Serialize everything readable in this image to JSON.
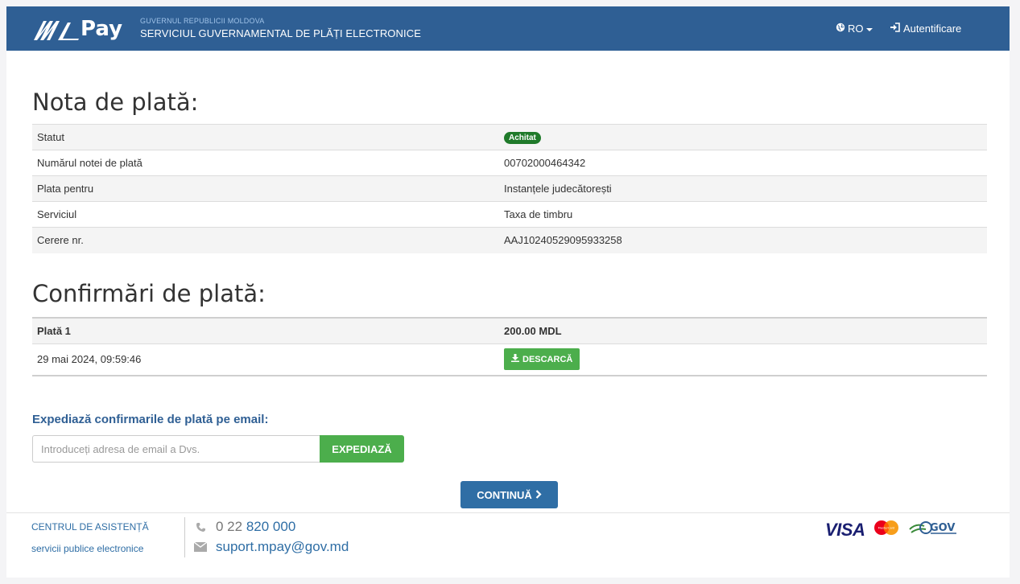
{
  "header": {
    "brand": "Pay",
    "gov_small": "GUVERNUL REPUBLICII MOLDOVA",
    "gov_big": "SERVICIUL GUVERNAMENTAL DE PLĂȚI ELECTRONICE",
    "language": "RO",
    "login": "Autentificare"
  },
  "invoice": {
    "title": "Nota de plată:",
    "rows": [
      {
        "label": "Statut",
        "value": "Achitat",
        "badge": true
      },
      {
        "label": "Numărul notei de plată",
        "value": "00702000464342"
      },
      {
        "label": "Plata pentru",
        "value": "Instanțele judecătorești"
      },
      {
        "label": "Serviciul",
        "value": "Taxa de timbru"
      },
      {
        "label": "Cerere nr.",
        "value": "AAJ10240529095933258"
      }
    ]
  },
  "confirmations": {
    "title": "Confirmări de plată:",
    "payment_label": "Plată 1",
    "amount": "200.00 MDL",
    "date": "29 mai 2024, 09:59:46",
    "download_label": "DESCARCĂ"
  },
  "email": {
    "label": "Expediază confirmarile de plată pe email:",
    "placeholder": "Introduceți adresa de email a Dvs.",
    "value": "",
    "send_label": "EXPEDIAZĂ"
  },
  "continue_label": "CONTINUĂ",
  "footer": {
    "help_line1": "CENTRUL DE ASISTENȚĂ",
    "help_line2": "servicii publice electronice",
    "phone_prefix": "0 22",
    "phone_number": "820 000",
    "email": "suport.mpay@gov.md",
    "visa": "VISA",
    "mastercard_text": "MasterCard",
    "gov_text": "GOV"
  },
  "colors": {
    "header_bg": "#2f5f94",
    "success": "#4cae4c",
    "badge": "#1f7a2a",
    "primary": "#2f6ea5"
  }
}
